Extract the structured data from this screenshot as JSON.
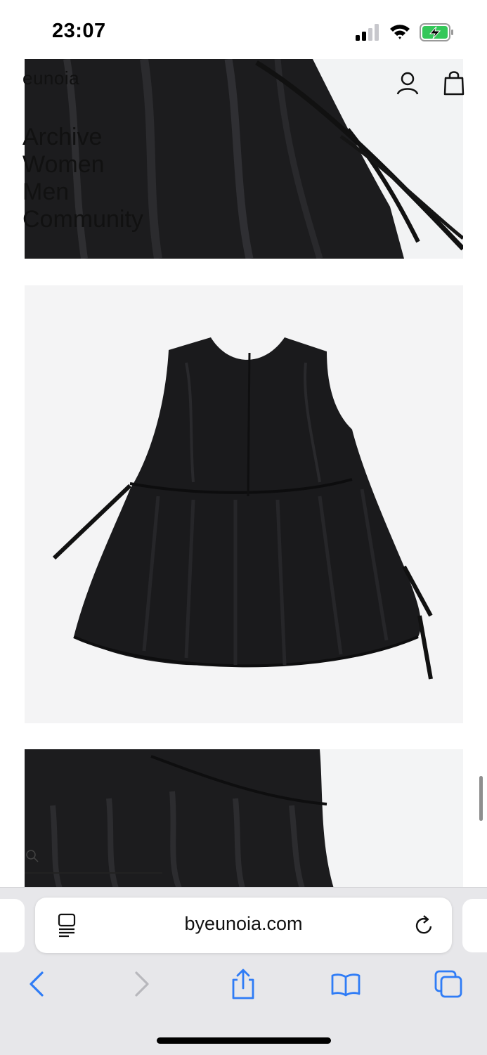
{
  "status_bar": {
    "time": "23:07",
    "icons": [
      "cellular-signal-icon",
      "wifi-icon",
      "battery-charging-icon"
    ]
  },
  "site": {
    "brand": "eunoia",
    "nav": [
      "Archive",
      "Women",
      "Men",
      "Community"
    ],
    "icons": [
      "account-icon",
      "shopping-bag-icon",
      "search-icon"
    ]
  },
  "product_images": [
    {
      "description_icon": "fabric-detail-photo"
    },
    {
      "description_icon": "black-sleeveless-dress-photo"
    },
    {
      "description_icon": "waist-gather-detail-photo"
    }
  ],
  "browser": {
    "url": "byeunoia.com",
    "toolbar_icons": [
      "back-icon",
      "forward-icon",
      "share-icon",
      "bookmarks-icon",
      "tabs-icon"
    ],
    "accent_color": "#2f7cf6",
    "disabled_color": "#b8b8bd"
  }
}
